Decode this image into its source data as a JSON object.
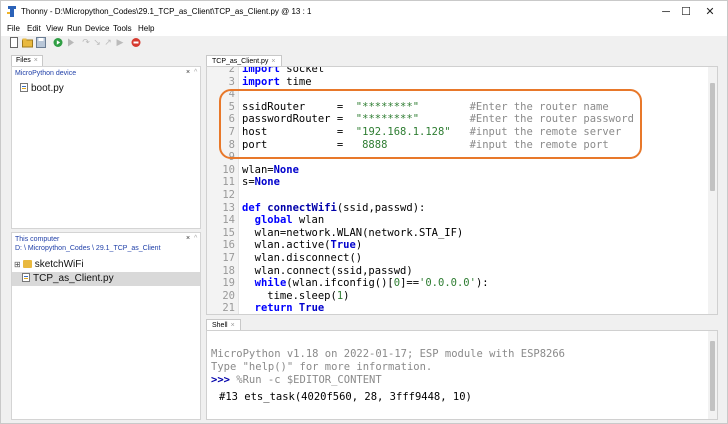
{
  "window": {
    "title": "Thonny  -  D:\\Micropython_Codes\\29.1_TCP_as_Client\\TCP_as_Client.py  @  13 : 1",
    "controls": {
      "minimize": "─",
      "maximize": "☐",
      "close": "✕"
    }
  },
  "menu": {
    "items": [
      "File",
      "Edit",
      "View",
      "Run",
      "Device",
      "Tools",
      "Help"
    ]
  },
  "toolbar": {
    "icons": [
      "new-file-icon",
      "open-file-icon",
      "save-icon",
      "run-icon",
      "debug-icon",
      "step-over-icon",
      "step-into-icon",
      "step-out-icon",
      "resume-icon",
      "stop-icon"
    ]
  },
  "files_tab": {
    "label": "Files",
    "close": "×"
  },
  "device_pane": {
    "header": "MicroPython device",
    "close": "×",
    "files": [
      {
        "name": "boot.py"
      }
    ]
  },
  "computer_pane": {
    "header": "This computer",
    "path": "D: \\ Micropython_Codes \\ 29.1_TCP_as_Client",
    "close": "×",
    "items": [
      {
        "name": "sketchWiFi",
        "type": "folder",
        "expander": "⊞"
      },
      {
        "name": "TCP_as_Client.py",
        "type": "file",
        "selected": true
      }
    ]
  },
  "editor": {
    "tab_label": "TCP_as_Client.py",
    "tab_close": "×",
    "lines": [
      {
        "n": "2",
        "segments": [
          {
            "t": "import",
            "c": "kw"
          },
          {
            "t": " socket",
            "c": ""
          }
        ]
      },
      {
        "n": "3",
        "segments": [
          {
            "t": "import",
            "c": "kw"
          },
          {
            "t": " time",
            "c": ""
          }
        ]
      },
      {
        "n": "4",
        "segments": []
      },
      {
        "n": "5",
        "segments": [
          {
            "t": "ssidRouter     =  ",
            "c": ""
          },
          {
            "t": "\"********\"",
            "c": "str"
          },
          {
            "t": "        ",
            "c": ""
          },
          {
            "t": "#Enter the router name",
            "c": "cmt"
          }
        ]
      },
      {
        "n": "6",
        "segments": [
          {
            "t": "passwordRouter =  ",
            "c": ""
          },
          {
            "t": "\"********\"",
            "c": "str"
          },
          {
            "t": "        ",
            "c": ""
          },
          {
            "t": "#Enter the router password",
            "c": "cmt"
          }
        ]
      },
      {
        "n": "7",
        "segments": [
          {
            "t": "host           =  ",
            "c": ""
          },
          {
            "t": "\"192.168.1.128\"",
            "c": "str"
          },
          {
            "t": "   ",
            "c": ""
          },
          {
            "t": "#input the remote server",
            "c": "cmt"
          }
        ]
      },
      {
        "n": "8",
        "segments": [
          {
            "t": "port           =   ",
            "c": ""
          },
          {
            "t": "8888",
            "c": "num"
          },
          {
            "t": "             ",
            "c": ""
          },
          {
            "t": "#input the remote port",
            "c": "cmt"
          }
        ]
      },
      {
        "n": "9",
        "segments": []
      },
      {
        "n": "10",
        "segments": [
          {
            "t": "wlan=",
            "c": ""
          },
          {
            "t": "None",
            "c": "kw2"
          }
        ]
      },
      {
        "n": "11",
        "segments": [
          {
            "t": "s=",
            "c": ""
          },
          {
            "t": "None",
            "c": "kw2"
          }
        ]
      },
      {
        "n": "12",
        "segments": []
      },
      {
        "n": "13",
        "segments": [
          {
            "t": "def",
            "c": "kw"
          },
          {
            "t": " ",
            "c": ""
          },
          {
            "t": "connectWifi",
            "c": "fn"
          },
          {
            "t": "(ssid,passwd):",
            "c": ""
          }
        ]
      },
      {
        "n": "14",
        "segments": [
          {
            "t": "  ",
            "c": ""
          },
          {
            "t": "global",
            "c": "kw"
          },
          {
            "t": " wlan",
            "c": ""
          }
        ]
      },
      {
        "n": "15",
        "segments": [
          {
            "t": "  wlan=network.WLAN(network.STA_IF)",
            "c": ""
          }
        ]
      },
      {
        "n": "16",
        "segments": [
          {
            "t": "  wlan.active(",
            "c": ""
          },
          {
            "t": "True",
            "c": "kw2"
          },
          {
            "t": ")",
            "c": ""
          }
        ]
      },
      {
        "n": "17",
        "segments": [
          {
            "t": "  wlan.disconnect()",
            "c": ""
          }
        ]
      },
      {
        "n": "18",
        "segments": [
          {
            "t": "  wlan.connect(ssid,passwd)",
            "c": ""
          }
        ]
      },
      {
        "n": "19",
        "segments": [
          {
            "t": "  ",
            "c": ""
          },
          {
            "t": "while",
            "c": "kw"
          },
          {
            "t": "(wlan.ifconfig()[",
            "c": ""
          },
          {
            "t": "0",
            "c": "num"
          },
          {
            "t": "]==",
            "c": ""
          },
          {
            "t": "'0.0.0.0'",
            "c": "str"
          },
          {
            "t": "):",
            "c": ""
          }
        ]
      },
      {
        "n": "20",
        "segments": [
          {
            "t": "    time.sleep(",
            "c": ""
          },
          {
            "t": "1",
            "c": "num"
          },
          {
            "t": ")",
            "c": ""
          }
        ]
      },
      {
        "n": "21",
        "segments": [
          {
            "t": "  ",
            "c": ""
          },
          {
            "t": "return",
            "c": "kw"
          },
          {
            "t": " ",
            "c": ""
          },
          {
            "t": "True",
            "c": "kw2"
          }
        ]
      }
    ]
  },
  "shell": {
    "tab_label": "Shell",
    "tab_close": "×",
    "banner1": "MicroPython v1.18 on 2022-01-17; ESP module with ESP8266",
    "banner2": "Type \"help()\" for more information.",
    "prompt": ">>>",
    "command": " %Run -c $EDITOR_CONTENT",
    "output": "#13 ets_task(4020f560, 28, 3fff9448, 10)"
  },
  "colors": {
    "highlight": "#e8782a",
    "keyword": "#0000ff",
    "string": "#2e7d32",
    "comment": "#8a8a8a",
    "selection": "#d9d9d9"
  }
}
